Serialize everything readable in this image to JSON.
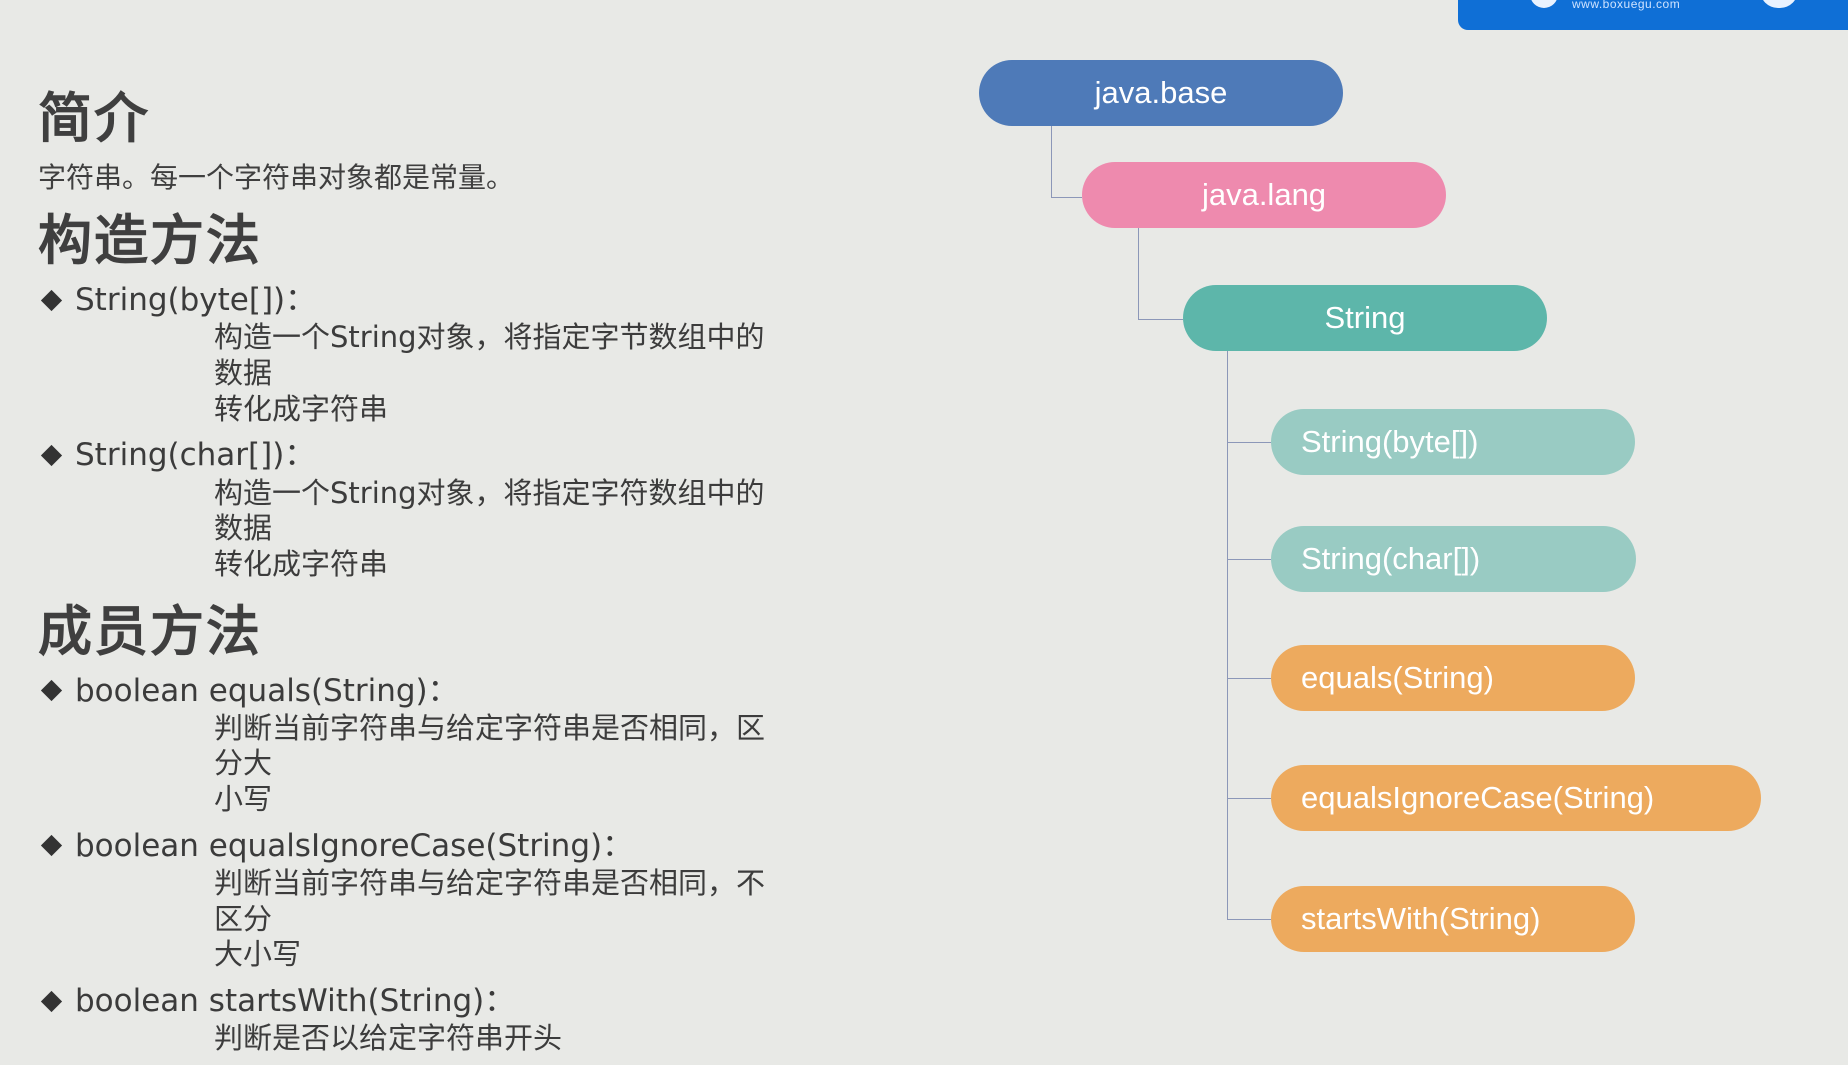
{
  "logo": {
    "site_text": "www.boxuegu.com"
  },
  "left": {
    "intro_title": "简介",
    "intro_text": "字符串。每一个字符串对象都是常量。",
    "constructors_title": "构造方法",
    "constructors": [
      {
        "signature": "String(byte[])：",
        "desc_line1": "构造一个String对象，将指定字节数组中的数据",
        "desc_line2": "转化成字符串"
      },
      {
        "signature": "String(char[])：",
        "desc_line1": "构造一个String对象，将指定字符数组中的数据",
        "desc_line2": "转化成字符串"
      }
    ],
    "members_title": "成员方法",
    "members": [
      {
        "signature": "boolean equals(String)：",
        "desc_line1": "判断当前字符串与给定字符串是否相同，区分大",
        "desc_line2": "小写"
      },
      {
        "signature": "boolean  equalsIgnoreCase(String)：",
        "desc_line1": "判断当前字符串与给定字符串是否相同，不区分",
        "desc_line2": "大小写"
      },
      {
        "signature": "boolean  startsWith(String)：",
        "desc_line1": "判断是否以给定字符串开头",
        "desc_line2": ""
      }
    ]
  },
  "diagram": {
    "module": "java.base",
    "package": "java.lang",
    "class": "String",
    "constructors": [
      "String(byte[])",
      "String(char[])"
    ],
    "methods": [
      "equals(String)",
      "equalsIgnoreCase(String)",
      "startsWith(String)"
    ]
  },
  "colors": {
    "background": "#e8e9e6",
    "module": "#4e7ab8",
    "package": "#ee8aae",
    "class": "#5db6aa",
    "constructor": "#99cbc3",
    "method": "#edaa5e",
    "logo_blue": "#0f6fd6"
  }
}
